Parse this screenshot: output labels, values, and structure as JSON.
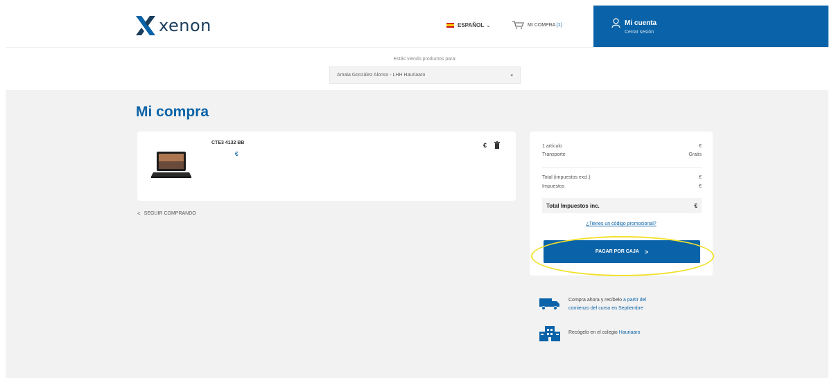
{
  "header": {
    "logo_text": "xenon",
    "language": "ESPAÑOL",
    "cart_label": "MI COMPRA",
    "cart_count": "(1)",
    "account_title": "Mi cuenta",
    "account_subtitle": "Cerrar sesión"
  },
  "viewing": {
    "label": "Estás viendo productos para:",
    "selected": "Amaia González Alonso - LHH Hauriaaro"
  },
  "page_title": "Mi compra",
  "item": {
    "code": "CTE3 4132 BB",
    "price": "€",
    "total": "€"
  },
  "keep_shopping": "SEGUIR COMPRANDO",
  "summary": {
    "items_label": "1 artículo",
    "items_value": "€",
    "shipping_label": "Transporte",
    "shipping_value": "Gratis",
    "subtotal_label": "Total (impuestos excl.)",
    "subtotal_value": "€",
    "taxes_label": "Impuestos",
    "taxes_value": "€",
    "total_label": "Total Impuestos inc.",
    "total_value": "€",
    "promo_link": "¿Tienes un código promocional?",
    "pay_button": "PAGAR POR CAJA"
  },
  "info": {
    "delivery_text": "Compra ahora y recíbelo",
    "delivery_link": "a partir del",
    "delivery_line2": "comienzo del curso en Septiembre",
    "pickup_text": "Recógelo en el colegio",
    "pickup_link": "Hauriaaro"
  },
  "colors": {
    "brand_blue": "#0a63a8",
    "background_gray": "#f2f2f2",
    "highlight_yellow": "#f2e02a"
  }
}
